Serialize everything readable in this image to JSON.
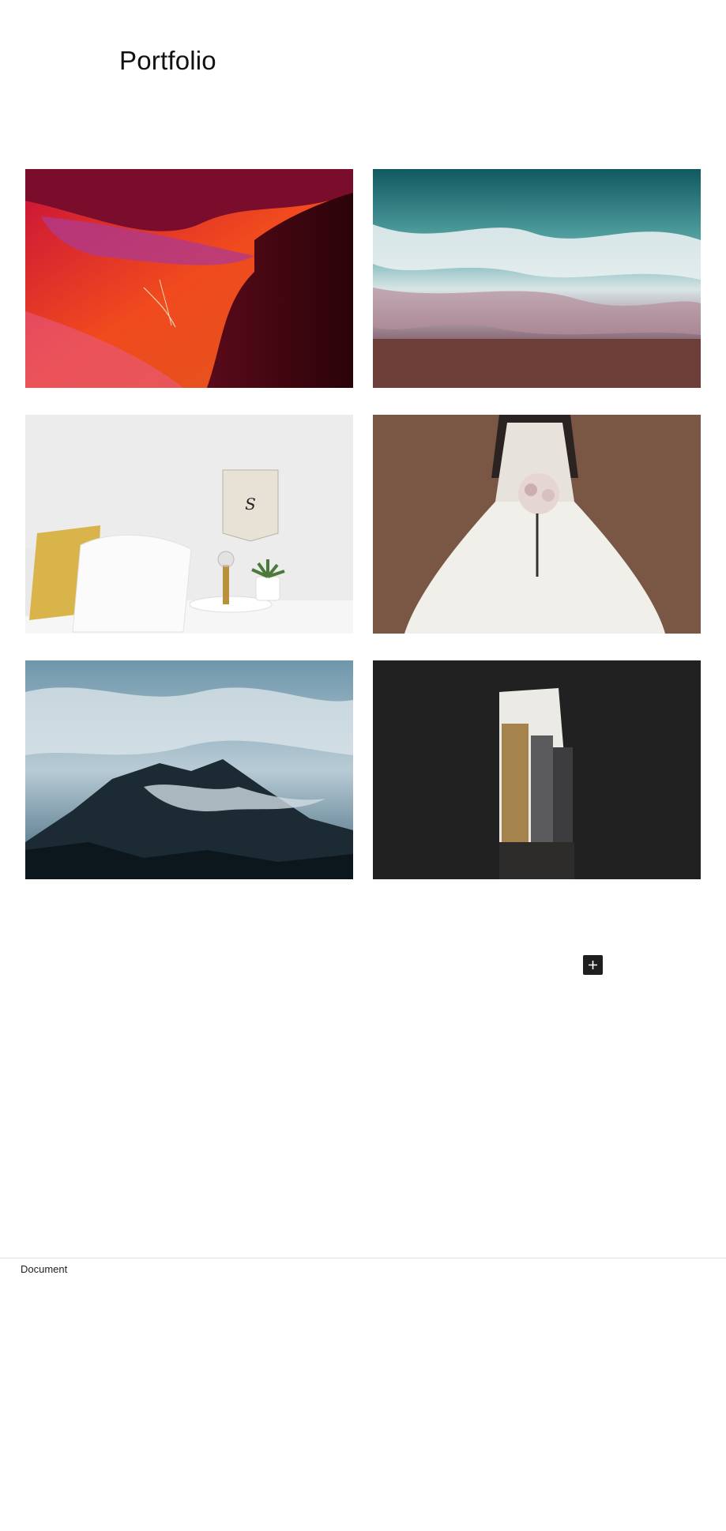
{
  "page": {
    "title": "Portfolio"
  },
  "gallery": {
    "images": [
      {
        "subject": "red sandstone slot canyon"
      },
      {
        "subject": "aerial ocean waves on sand"
      },
      {
        "subject": "bedroom corner with pillow, lamp and plant"
      },
      {
        "subject": "bride holding bouquet"
      },
      {
        "subject": "misty mountain peaks"
      },
      {
        "subject": "city buildings through dark opening"
      }
    ]
  },
  "editor": {
    "add_block_icon": "plus-icon"
  },
  "footer": {
    "breadcrumb": "Document"
  },
  "colors": {
    "button_bg": "#1e1e1e",
    "divider": "#e0e0e0"
  }
}
